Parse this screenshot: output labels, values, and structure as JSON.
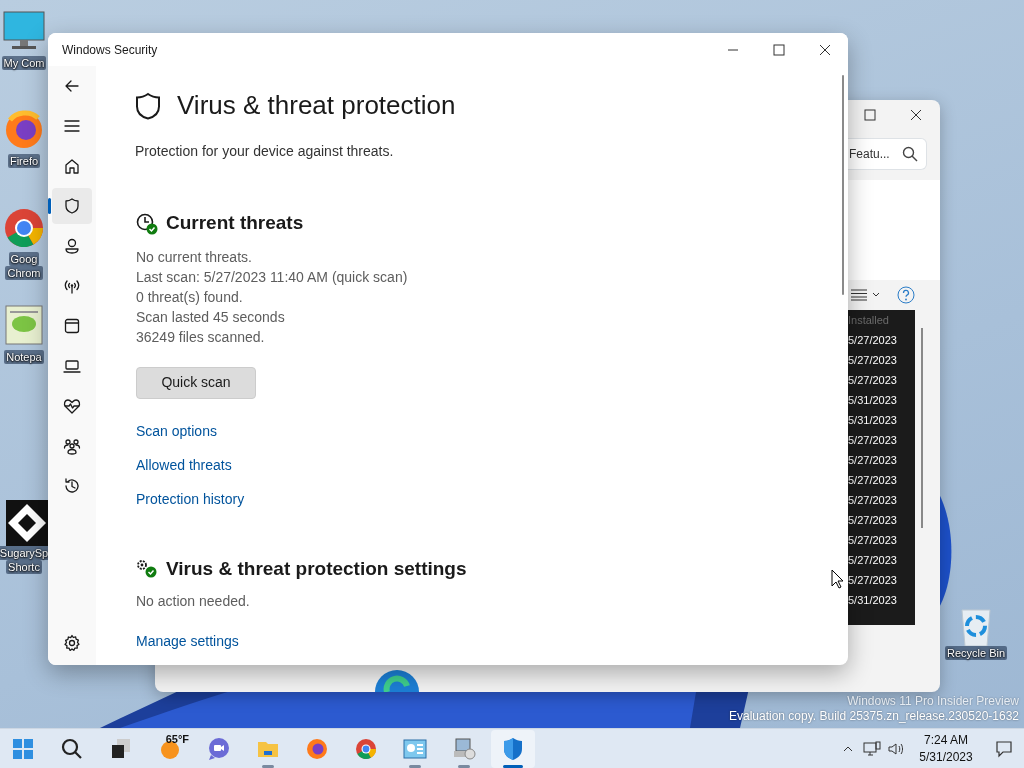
{
  "desktop_icons": [
    {
      "kind": "monitor",
      "lines": [
        "My Com"
      ]
    },
    {
      "kind": "firefox",
      "lines": [
        "Firefo"
      ]
    },
    {
      "kind": "chrome",
      "lines": [
        "Goog",
        "Chrom"
      ]
    },
    {
      "kind": "notepad",
      "lines": [
        "Notepa"
      ]
    },
    {
      "kind": "sugary",
      "lines": [
        "SugarySp",
        "Shortc"
      ]
    }
  ],
  "recycle_bin": {
    "label": "Recycle Bin"
  },
  "background_window": {
    "search": {
      "value": "Featu..."
    },
    "column_header": "Installed",
    "dates": [
      "5/27/2023",
      "5/27/2023",
      "5/27/2023",
      "5/31/2023",
      "5/31/2023",
      "5/27/2023",
      "5/27/2023",
      "5/27/2023",
      "5/27/2023",
      "5/27/2023",
      "5/27/2023",
      "5/27/2023",
      "5/27/2023",
      "5/31/2023"
    ]
  },
  "security_window": {
    "title": "Windows Security",
    "nav": [
      {
        "kind": "back",
        "selected": false
      },
      {
        "kind": "menu",
        "selected": false
      },
      {
        "kind": "home",
        "selected": false
      },
      {
        "kind": "shield",
        "selected": true
      },
      {
        "kind": "account",
        "selected": false
      },
      {
        "kind": "network",
        "selected": false
      },
      {
        "kind": "app",
        "selected": false
      },
      {
        "kind": "device",
        "selected": false
      },
      {
        "kind": "health",
        "selected": false
      },
      {
        "kind": "family",
        "selected": false
      },
      {
        "kind": "history",
        "selected": false
      }
    ],
    "page": {
      "heading": "Virus & threat protection",
      "subtitle": "Protection for your device against threats.",
      "sections": [
        {
          "kind": "threats",
          "heading": "Current threats",
          "lines": [
            "No current threats.",
            "Last scan: 5/27/2023 11:40 AM (quick scan)",
            "0 threat(s) found.",
            "Scan lasted 45 seconds",
            "36249 files scanned."
          ],
          "button": "Quick scan",
          "links": [
            "Scan options",
            "Allowed threats",
            "Protection history"
          ]
        },
        {
          "kind": "settings",
          "heading": "Virus & threat protection settings",
          "lines": [
            "No action needed."
          ],
          "links": [
            "Manage settings"
          ]
        }
      ]
    }
  },
  "watermark": [
    "Windows 11 Pro Insider Preview",
    "Evaluation copy. Build 25375.zn_release.230520-1632"
  ],
  "taskbar": {
    "apps": [
      {
        "kind": "start",
        "running": false
      },
      {
        "kind": "search",
        "running": false
      },
      {
        "kind": "taskview",
        "running": false
      },
      {
        "kind": "weather",
        "running": false,
        "text": "65°F"
      },
      {
        "kind": "meet",
        "running": false
      },
      {
        "kind": "explorer",
        "running": true
      },
      {
        "kind": "firefox",
        "running": false
      },
      {
        "kind": "chrome",
        "running": false
      },
      {
        "kind": "controlpanel",
        "running": true
      },
      {
        "kind": "setup",
        "running": true
      },
      {
        "kind": "security",
        "running": true,
        "selected": true
      }
    ],
    "time": "7:24 AM",
    "date": "5/31/2023"
  }
}
